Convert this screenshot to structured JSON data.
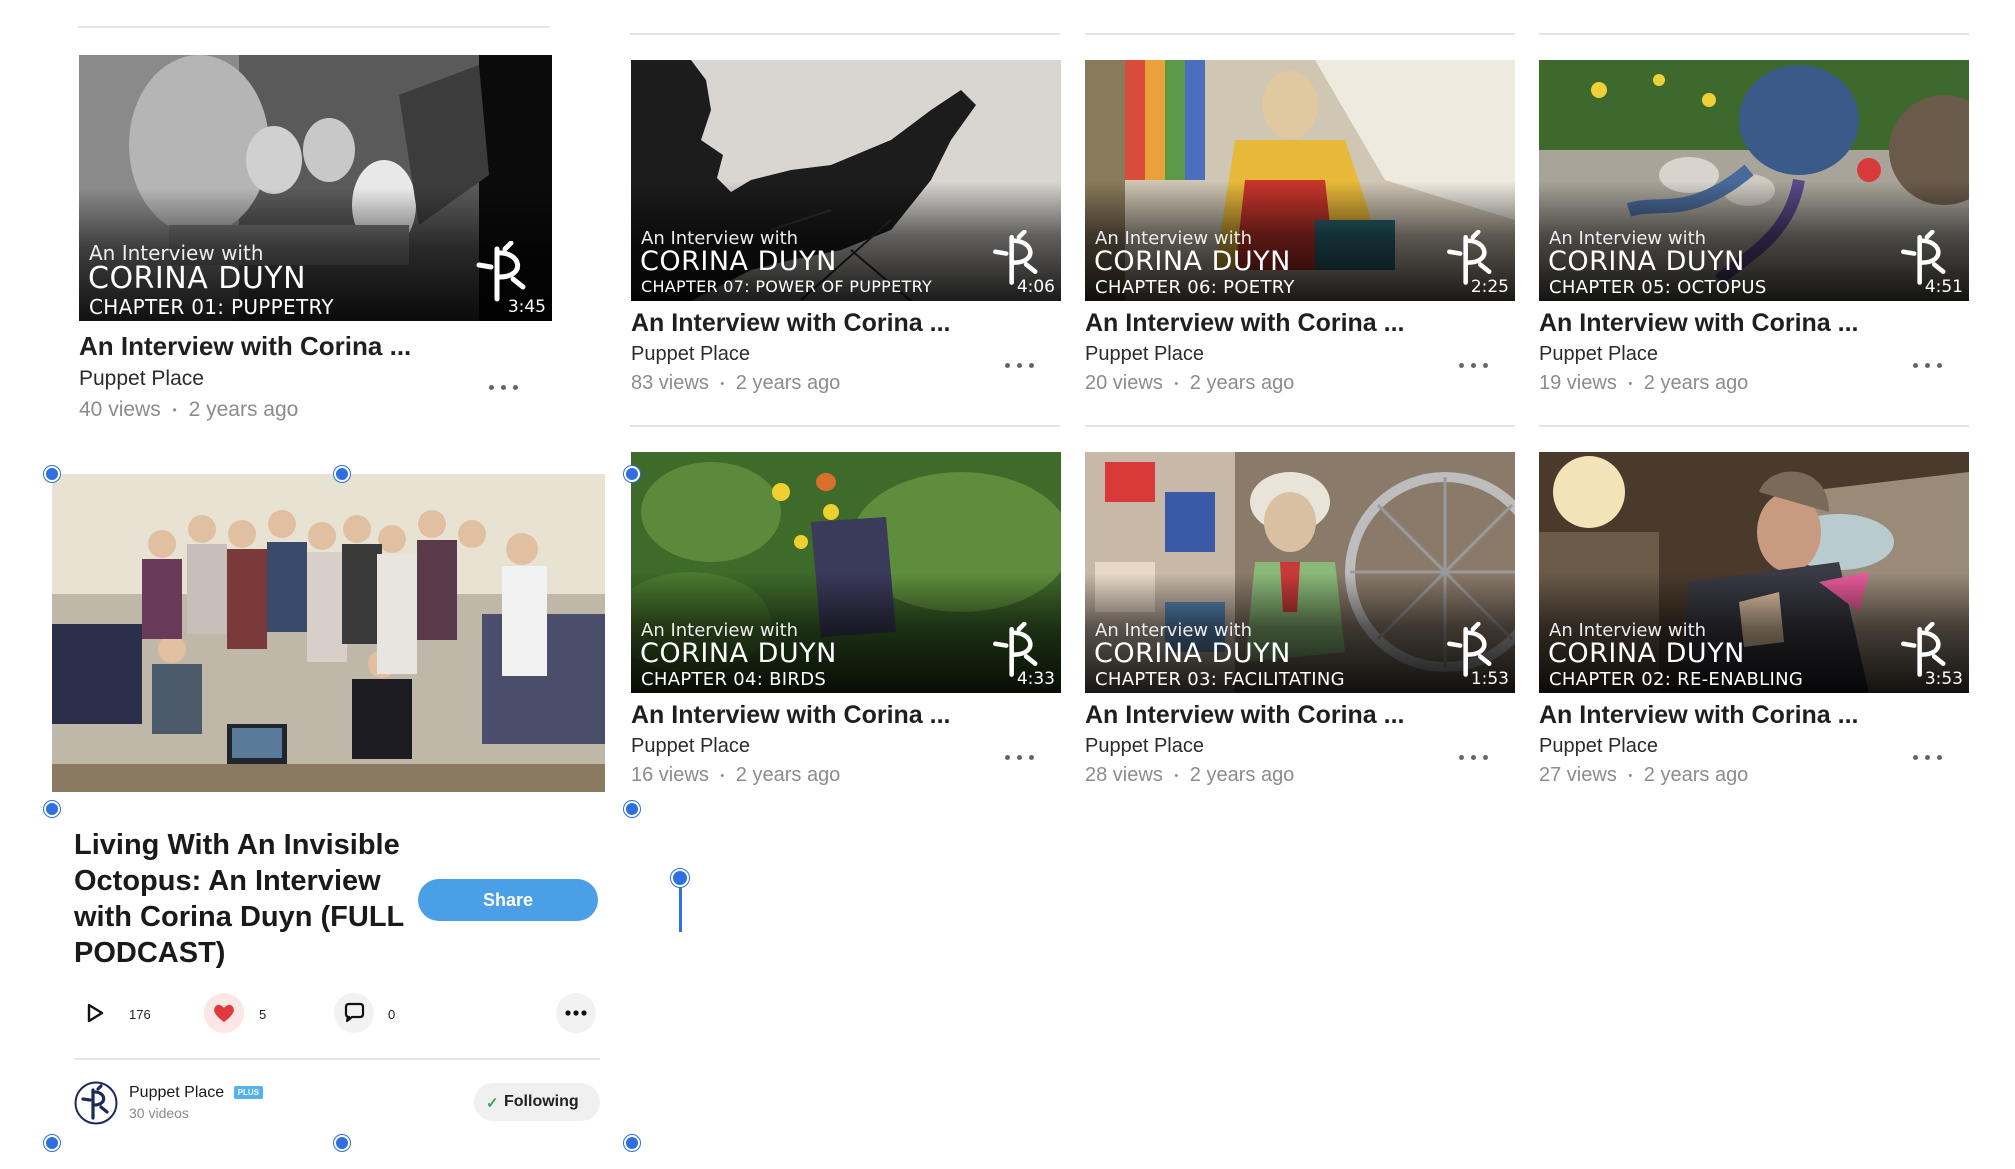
{
  "cards": [
    {
      "title": "An Interview with Corina ...",
      "channel": "Puppet Place",
      "views": "40 views",
      "sep": "•",
      "age": "2 years ago",
      "ovl": {
        "line1": "An Interview with",
        "line2": "CORINA DUYN",
        "line3": "CHAPTER 01: PUPPETRY"
      },
      "duration": "3:45"
    },
    {
      "title": "An Interview with Corina ...",
      "channel": "Puppet Place",
      "views": "83 views",
      "sep": "•",
      "age": "2 years ago",
      "ovl": {
        "line1": "An Interview with",
        "line2": "CORINA DUYN",
        "line3": "CHAPTER 07: POWER OF PUPPETRY"
      },
      "duration": "4:06"
    },
    {
      "title": "An Interview with Corina ...",
      "channel": "Puppet Place",
      "views": "20 views",
      "sep": "•",
      "age": "2 years ago",
      "ovl": {
        "line1": "An Interview with",
        "line2": "CORINA DUYN",
        "line3": "CHAPTER 06: POETRY"
      },
      "duration": "2:25"
    },
    {
      "title": "An Interview with Corina ...",
      "channel": "Puppet Place",
      "views": "19 views",
      "sep": "•",
      "age": "2 years ago",
      "ovl": {
        "line1": "An Interview with",
        "line2": "CORINA DUYN",
        "line3": "CHAPTER 05: OCTOPUS"
      },
      "duration": "4:51"
    },
    {
      "title": "An Interview with Corina ...",
      "channel": "Puppet Place",
      "views": "16 views",
      "sep": "•",
      "age": "2 years ago",
      "ovl": {
        "line1": "An Interview with",
        "line2": "CORINA DUYN",
        "line3": "CHAPTER 04: BIRDS"
      },
      "duration": "4:33"
    },
    {
      "title": "An Interview with Corina ...",
      "channel": "Puppet Place",
      "views": "28 views",
      "sep": "•",
      "age": "2 years ago",
      "ovl": {
        "line1": "An Interview with",
        "line2": "CORINA DUYN",
        "line3": "CHAPTER 03: FACILITATING"
      },
      "duration": "1:53"
    },
    {
      "title": "An Interview with Corina ...",
      "channel": "Puppet Place",
      "views": "27 views",
      "sep": "•",
      "age": "2 years ago",
      "ovl": {
        "line1": "An Interview with",
        "line2": "CORINA DUYN",
        "line3": "CHAPTER 02: RE-ENABLING"
      },
      "duration": "3:53"
    }
  ],
  "featured": {
    "title_lines": [
      "Living With An Invisible",
      "Octopus: An Interview",
      "with Corina Duyn (FULL",
      "PODCAST)"
    ],
    "share_label": "Share",
    "plays": "176",
    "likes": "5",
    "comments": "0",
    "channel_name": "Puppet Place",
    "plus_badge": "PLUS",
    "video_count": "30 videos",
    "following_label": "Following",
    "check_glyph": "✓"
  },
  "colors": {
    "accent": "#4a9fe6",
    "like": "#e0393e",
    "selection": "#2f6fe0",
    "follow_check": "#3aa85a"
  },
  "icons": [
    "play-icon",
    "heart-icon",
    "comment-icon",
    "more-icon",
    "check-icon",
    "puppet-place-logo"
  ]
}
